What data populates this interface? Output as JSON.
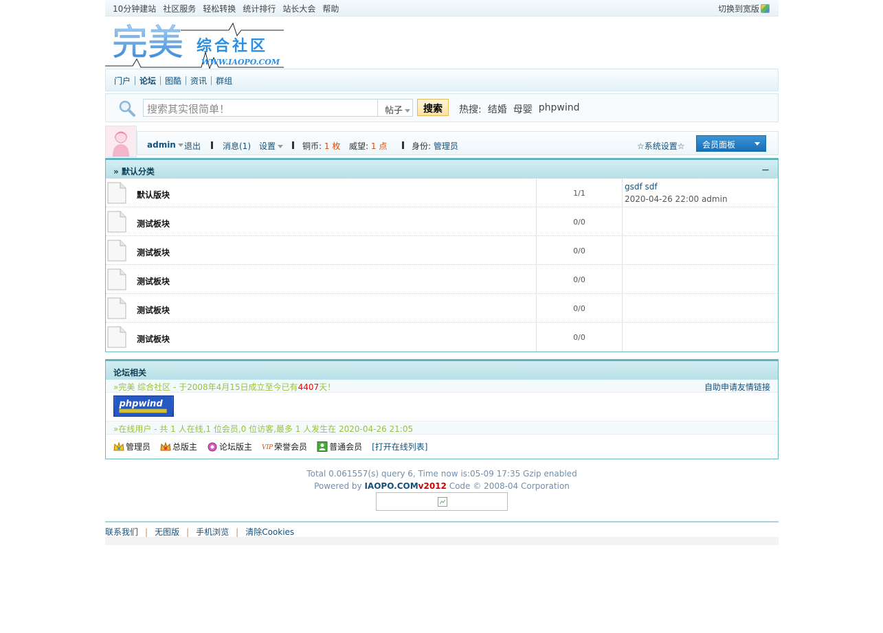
{
  "topbar": {
    "links": [
      "10分钟建站",
      "社区服务",
      "轻松转换",
      "统计排行",
      "站长大会",
      "帮助"
    ],
    "switch_label": "切换到宽版"
  },
  "nav": {
    "items": [
      "门户",
      "论坛",
      "图酷",
      "资讯",
      "群组"
    ],
    "active_index": 1
  },
  "search": {
    "placeholder": "搜索其实很简单！",
    "scope": "帖子",
    "button": "搜索",
    "hot_label": "热搜:",
    "hot_words": [
      "结婚",
      "母婴",
      "phpwind"
    ]
  },
  "userbar": {
    "username": "admin",
    "logout": "退出",
    "messages": "消息(1)",
    "settings": "设置",
    "coins_label": "铜币:",
    "coins_value": "1 枚",
    "prestige_label": "威望:",
    "prestige_value": "1 点",
    "identity_label": "身份:",
    "identity_value": "管理员",
    "system_settings": "☆系统设置☆",
    "member_panel": "会员面板"
  },
  "forum": {
    "category_title": "» 默认分类",
    "collapse": "－",
    "boards": [
      {
        "name": "默认版块",
        "count": "1/1",
        "last_title": "gsdf sdf",
        "last_info": "2020-04-26 22:00 admin"
      },
      {
        "name": "测试板块",
        "count": "0/0",
        "last_title": "",
        "last_info": ""
      },
      {
        "name": "测试板块",
        "count": "0/0",
        "last_title": "",
        "last_info": ""
      },
      {
        "name": "测试板块",
        "count": "0/0",
        "last_title": "",
        "last_info": ""
      },
      {
        "name": "测试板块",
        "count": "0/0",
        "last_title": "",
        "last_info": ""
      },
      {
        "name": "测试板块",
        "count": "0/0",
        "last_title": "",
        "last_info": ""
      }
    ]
  },
  "related": {
    "title": "论坛相关",
    "founded_prefix": "»完美 综合社区 - 于2008年4月15日成立至今已有",
    "founded_days": "4407",
    "founded_suffix": "天！",
    "friend_link": "自助申请友情链接",
    "online_text": "»在线用户 - 共 1 人在线,1 位会员,0 位访客,最多 1 人发生在 2020-04-26 21:05",
    "legend": [
      "管理员",
      "总版主",
      "论坛版主",
      "荣誉会员",
      "普通会员"
    ],
    "open_list": "[打开在线列表]"
  },
  "footer": {
    "stats": "Total 0.061557(s) query 6, Time now is:05-09 17:35 Gzip enabled",
    "powered_prefix": "Powered by ",
    "brand": "IAOPO.COM",
    "version": "v2012",
    "code_text": " Code © 2008-04 Corporation",
    "links": [
      "联系我们",
      "无图版",
      "手机浏览",
      "清除Cookies"
    ]
  },
  "logo": {
    "main": "完美",
    "sub": "综合社区",
    "url": "WWW.IAOPO.COM"
  },
  "colors": {
    "link": "#14517a",
    "accent_red": "#e04a00",
    "border": "#6cb6c2"
  }
}
